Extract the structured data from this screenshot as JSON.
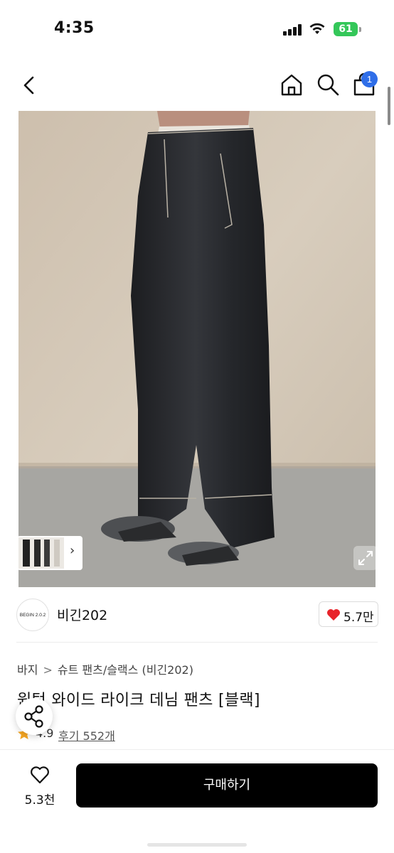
{
  "status_bar": {
    "time": "4:35",
    "battery": "61",
    "icons": [
      "signal-icon",
      "wifi-icon",
      "battery-icon"
    ]
  },
  "header": {
    "icons": [
      "back-icon",
      "home-icon",
      "search-icon",
      "cart-icon"
    ],
    "cart_badge": "1",
    "badge_color": "#2f6ee8"
  },
  "product_image": {
    "description_icon": "product-photo",
    "thumbnail_arrow": "›"
  },
  "brand": {
    "logo_text": "BEGIN 2.0.2",
    "name": "비긴202",
    "likes": "5.7만",
    "like_color": "#e8232a"
  },
  "breadcrumb": {
    "items": [
      "바지",
      "슈트 팬츠/슬랙스",
      "(비긴202)"
    ],
    "separator": ">"
  },
  "product": {
    "title": "원턱 와이드 라이크 데님 팬츠 [블랙]",
    "rating": "4.9",
    "reviews": "후기 552개",
    "star_color": "#f5a623"
  },
  "bottom_bar": {
    "wish_count": "5.3천",
    "buy_label": "구매하기"
  }
}
